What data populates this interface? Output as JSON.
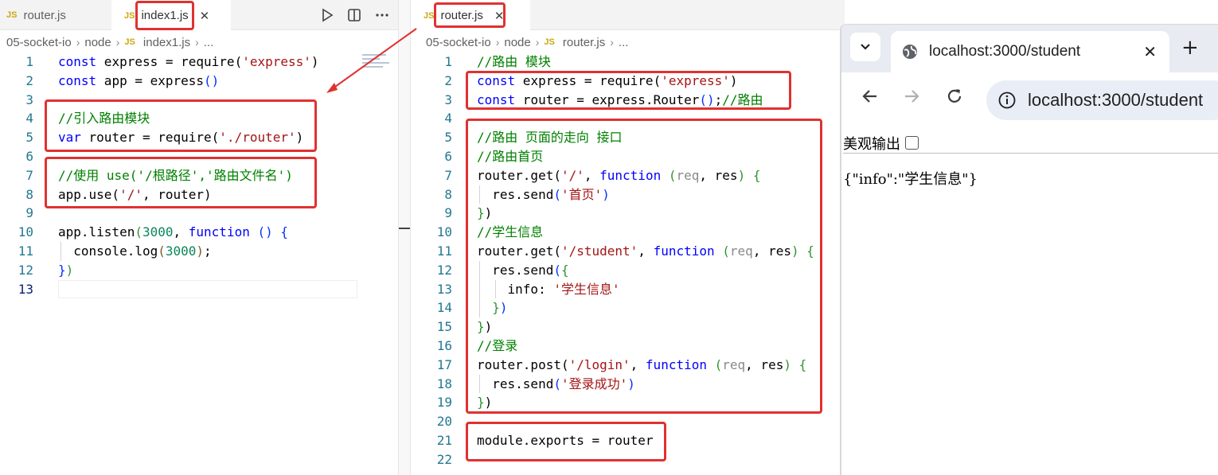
{
  "left_editor": {
    "tabs": [
      {
        "label": "router.js",
        "active": false
      },
      {
        "label": "index1.js",
        "active": true
      }
    ],
    "breadcrumb": [
      "05-socket-io",
      "node",
      "index1.js",
      "..."
    ],
    "line_numbers": [
      "1",
      "2",
      "3",
      "4",
      "5",
      "6",
      "7",
      "8",
      "9",
      "10",
      "11",
      "12",
      "13"
    ]
  },
  "right_editor": {
    "tabs": [
      {
        "label": "router.js",
        "active": true
      }
    ],
    "breadcrumb": [
      "05-socket-io",
      "node",
      "router.js",
      "..."
    ],
    "line_numbers": [
      "1",
      "2",
      "3",
      "4",
      "5",
      "6",
      "7",
      "8",
      "9",
      "10",
      "11",
      "12",
      "13",
      "14",
      "15",
      "16",
      "17",
      "18",
      "19",
      "20",
      "21",
      "22"
    ]
  },
  "browser": {
    "tab_title": "localhost:3000/student",
    "url": "localhost:3000/student",
    "checkbox_label": "美观输出",
    "body_text": "{\"info\":\"学生信息\"}"
  },
  "icons": {
    "file_type": "js-file-icon",
    "run": "play-icon",
    "split": "split-editor-icon",
    "more": "more-actions-icon",
    "close": "close-icon",
    "back": "back-arrow-icon",
    "forward": "forward-arrow-icon",
    "reload": "reload-icon",
    "site_info": "info-icon",
    "new_tab": "plus-icon",
    "tab_search": "chevron-down-icon"
  },
  "colors": {
    "highlight_box": "#e03131",
    "keyword": "#0000ff",
    "string": "#a31515",
    "comment": "#008000",
    "number": "#098658"
  }
}
